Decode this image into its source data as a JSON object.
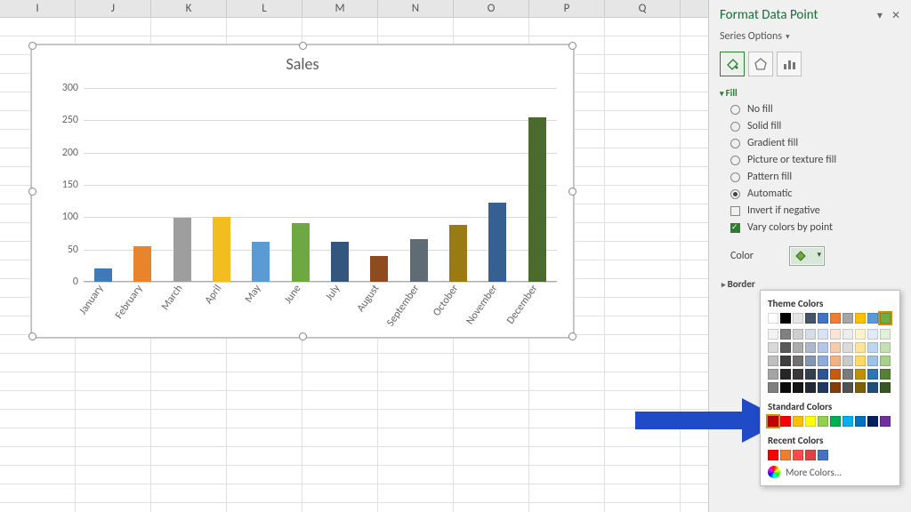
{
  "columns": [
    "I",
    "J",
    "K",
    "L",
    "M",
    "N",
    "O",
    "P",
    "Q"
  ],
  "chart_data": {
    "type": "bar",
    "title": "Sales",
    "categories": [
      "January",
      "February",
      "March",
      "April",
      "May",
      "June",
      "July",
      "August",
      "September",
      "October",
      "November",
      "December"
    ],
    "values": [
      20,
      55,
      98,
      100,
      62,
      90,
      62,
      40,
      65,
      87,
      122,
      252
    ],
    "ylim": [
      0,
      300
    ],
    "yticks": [
      0,
      50,
      100,
      150,
      200,
      250,
      300
    ],
    "colors": [
      "#4178b8",
      "#e8852c",
      "#9e9e9e",
      "#f4bd1f",
      "#5a9bd5",
      "#6ea840",
      "#33567f",
      "#8f4a1f",
      "#5f6b75",
      "#9a7a13",
      "#366092",
      "#4a6a2e"
    ],
    "selected_index": 5,
    "xlabel": "",
    "ylabel": ""
  },
  "pane": {
    "title": "Format Data Point",
    "series_options": "Series Options",
    "fill_section": "Fill",
    "border_section": "Border",
    "radios": {
      "no_fill": "No fill",
      "solid_fill": "Solid fill",
      "gradient_fill": "Gradient fill",
      "picture_fill": "Picture or texture fill",
      "pattern_fill": "Pattern fill",
      "automatic": "Automatic"
    },
    "checks": {
      "invert": "Invert if negative",
      "vary": "Vary colors by point"
    },
    "color_label": "Color"
  },
  "color_popup": {
    "theme_label": "Theme Colors",
    "standard_label": "Standard Colors",
    "recent_label": "Recent Colors",
    "more_label": "More Colors...",
    "theme_row_top": [
      "#ffffff",
      "#000000",
      "#e7e6e6",
      "#44546a",
      "#4472c4",
      "#ed7d31",
      "#a5a5a5",
      "#ffc000",
      "#5b9bd5",
      "#70ad47"
    ],
    "theme_shades": [
      [
        "#f2f2f2",
        "#7f7f7f",
        "#d0cece",
        "#d6dce4",
        "#d9e2f3",
        "#fbe5d5",
        "#ededed",
        "#fff2cc",
        "#deebf6",
        "#e2efd9"
      ],
      [
        "#d8d8d8",
        "#595959",
        "#aeabab",
        "#adb9ca",
        "#b4c6e7",
        "#f7cbac",
        "#dbdbdb",
        "#fee599",
        "#bdd7ee",
        "#c5e0b3"
      ],
      [
        "#bfbfbf",
        "#3f3f3f",
        "#757070",
        "#8496b0",
        "#8eaadb",
        "#f4b183",
        "#c9c9c9",
        "#ffd965",
        "#9cc3e5",
        "#a8d08d"
      ],
      [
        "#a5a5a5",
        "#262626",
        "#3a3838",
        "#323f4f",
        "#2f5496",
        "#c55a11",
        "#7b7b7b",
        "#bf9000",
        "#2e75b5",
        "#538135"
      ],
      [
        "#7f7f7f",
        "#0c0c0c",
        "#171616",
        "#222a35",
        "#1f3864",
        "#833c0b",
        "#525252",
        "#7f6000",
        "#1e4e79",
        "#375623"
      ]
    ],
    "standard_row": [
      "#c00000",
      "#ff0000",
      "#ffc000",
      "#ffff00",
      "#92d050",
      "#00b050",
      "#00b0f0",
      "#0070c0",
      "#002060",
      "#7030a0"
    ],
    "recent_row": [
      "#ff0000",
      "#ed7d31",
      "#ff4b4b",
      "#d94545",
      "#4472c4"
    ]
  }
}
